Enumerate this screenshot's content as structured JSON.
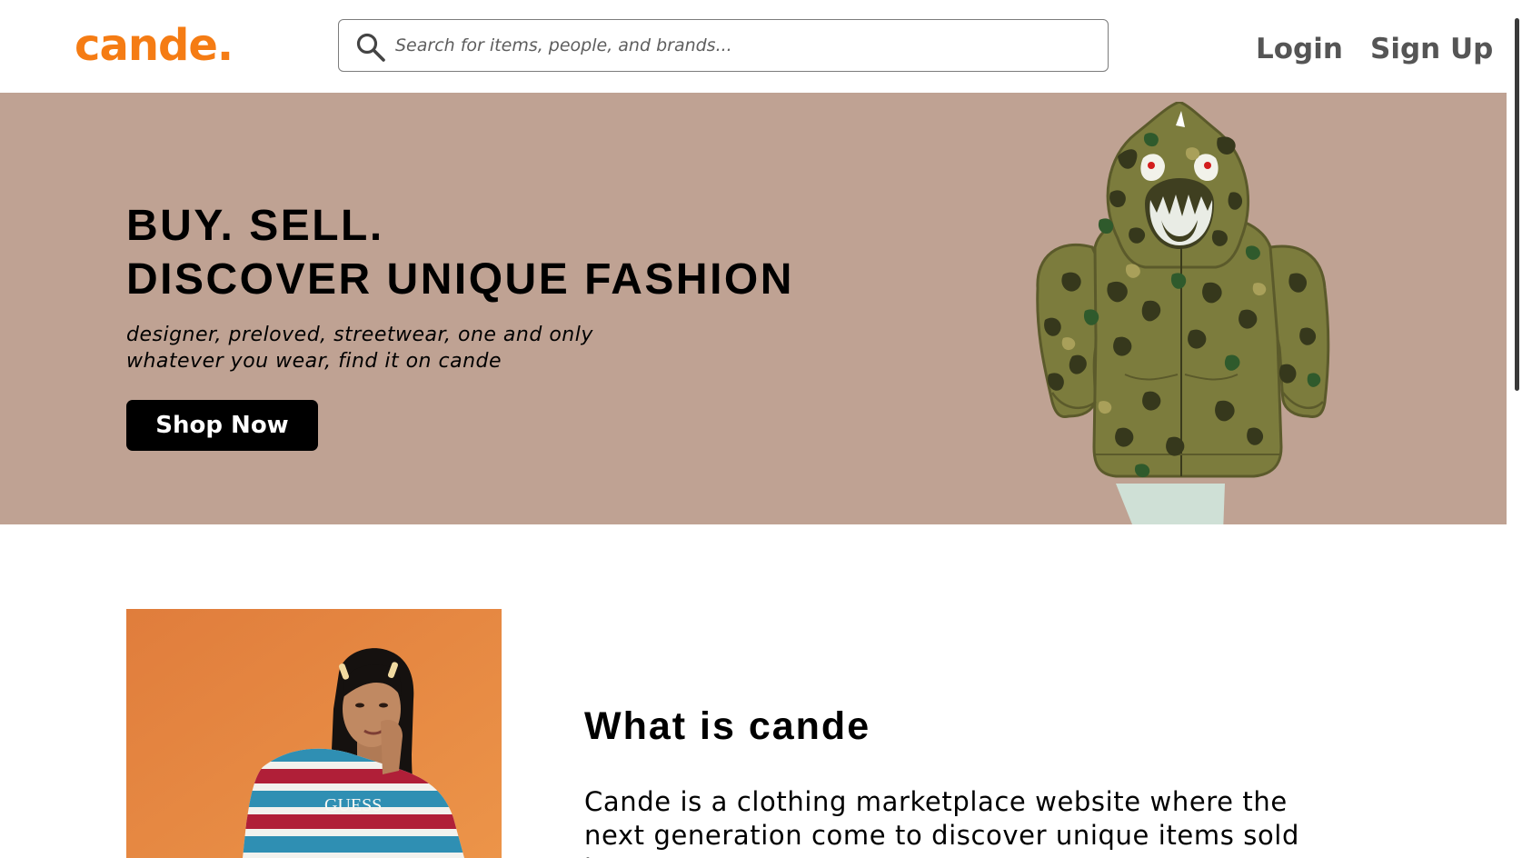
{
  "brand": {
    "logo_text": "cande.",
    "accent_color": "#f57c14"
  },
  "header": {
    "search": {
      "placeholder": "Search for items, people, and brands...",
      "value": "",
      "icon": "search-icon"
    },
    "nav": {
      "login_label": "Login",
      "signup_label": "Sign Up"
    }
  },
  "hero": {
    "background_color": "#bfa293",
    "title_line1": "BUY. SELL.",
    "title_line2": "DISCOVER UNIQUE FASHION",
    "subtitle_line1": "designer, preloved, streetwear, one and only",
    "subtitle_line2": "whatever you wear, find it on cande",
    "cta_label": "Shop Now",
    "image": "camo-shark-hoodie-illustration"
  },
  "about": {
    "heading": "What is cande",
    "body": "Cande is a clothing marketplace website where the next generation come to discover unique items sold by our",
    "image": "model-in-striped-shirt-photo",
    "shirt_print": "GUESS"
  }
}
